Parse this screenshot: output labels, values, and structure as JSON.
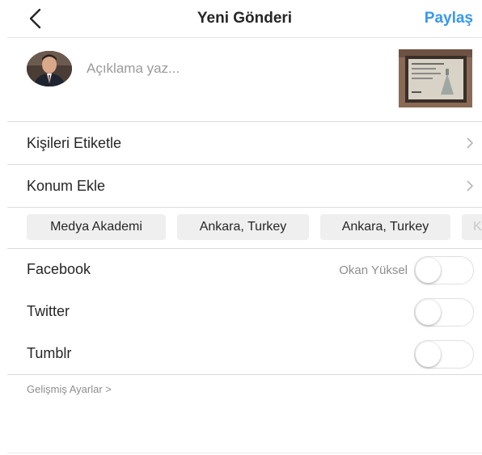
{
  "header": {
    "back_icon": "chevron-left-icon",
    "title": "Yeni Gönderi",
    "share_label": "Paylaş"
  },
  "caption": {
    "placeholder": "Açıklama yaz..."
  },
  "rows": {
    "tag_people": "Kişileri Etiketle",
    "add_location": "Konum Ekle"
  },
  "location_suggestions": [
    "Medya Akademi",
    "Ankara, Turkey",
    "Ankara, Turkey",
    "K"
  ],
  "share_to": [
    {
      "network": "Facebook",
      "account": "Okan Yüksel",
      "enabled": false
    },
    {
      "network": "Twitter",
      "account": "",
      "enabled": false
    },
    {
      "network": "Tumblr",
      "account": "",
      "enabled": false
    }
  ],
  "advanced_settings": "Gelişmiş Ayarlar  >",
  "colors": {
    "accent": "#3897f0",
    "text": "#262626",
    "muted": "#8e8e8e",
    "chip_bg": "#efefef"
  }
}
